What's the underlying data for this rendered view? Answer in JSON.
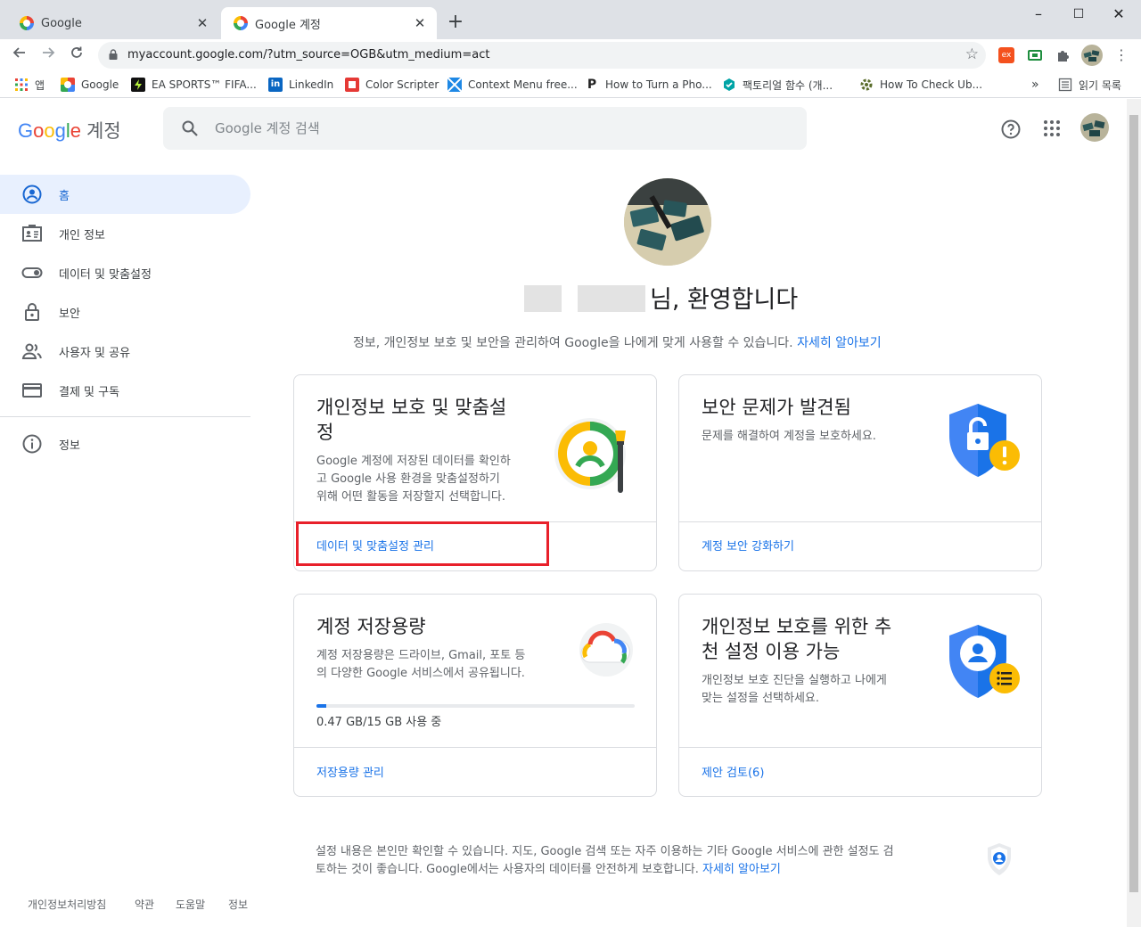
{
  "browser": {
    "tabs": [
      {
        "title": "Google",
        "close": "✕"
      },
      {
        "title": "Google 계정",
        "close": "✕"
      }
    ],
    "new_tab": "+",
    "window_controls": [
      "–",
      "☐",
      "✕"
    ],
    "url": "myaccount.google.com/?utm_source=OGB&utm_medium=act",
    "bookmarks": [
      {
        "label": "앱",
        "icon": "apps-grid-icon"
      },
      {
        "label": "Google",
        "icon": "google-icon"
      },
      {
        "label": "EA SPORTS™ FIFA...",
        "icon": "fifa-icon"
      },
      {
        "label": "LinkedIn",
        "icon": "linkedin-icon"
      },
      {
        "label": "Color Scripter",
        "icon": "color-scripter-icon"
      },
      {
        "label": "Context Menu free...",
        "icon": "context-menu-icon"
      },
      {
        "label": "How to Turn a Pho...",
        "icon": "p-icon"
      },
      {
        "label": "팩토리얼 함수 (개...",
        "icon": "factorial-icon"
      },
      {
        "label": "How To Check Ub...",
        "icon": "ubuntu-icon"
      }
    ],
    "bookmarks_overflow": "»",
    "reading_list": "읽기 목록",
    "extension_badge": "ex"
  },
  "header": {
    "logo_google": "Google",
    "logo_suffix": "계정",
    "search_placeholder": "Google 계정 검색"
  },
  "sidebar": {
    "items": [
      {
        "label": "홈",
        "icon": "home-user-icon"
      },
      {
        "label": "개인 정보",
        "icon": "id-card-icon"
      },
      {
        "label": "데이터 및 맞춤설정",
        "icon": "toggle-icon"
      },
      {
        "label": "보안",
        "icon": "lock-icon"
      },
      {
        "label": "사용자 및 공유",
        "icon": "people-icon"
      },
      {
        "label": "결제 및 구독",
        "icon": "credit-card-icon"
      }
    ],
    "info": {
      "label": "정보",
      "icon": "info-icon"
    }
  },
  "main": {
    "greeting": "님, 환영합니다",
    "intro": "정보, 개인정보 보호 및 보안을 관리하여 Google을 나에게 맞게 사용할 수 있습니다.",
    "intro_link": "자세히 알아보기",
    "cards": [
      {
        "title_line1": "개인정보 보호 및 맞춤설",
        "title_line2": "정",
        "desc_lines": [
          "Google 계정에 저장된 데이터를 확인하",
          "고 Google 사용 환경을 맞춤설정하기",
          "위해 어떤 활동을 저장할지 선택합니다."
        ],
        "link": "데이터 및 맞춤설정 관리"
      },
      {
        "title_line1": "보안 문제가 발견됨",
        "desc_lines": [
          "문제를 해결하여 계정을 보호하세요."
        ],
        "link": "계정 보안 강화하기"
      },
      {
        "title_line1": "계정 저장용량",
        "desc_lines": [
          "계정 저장용량은 드라이브, Gmail, 포토 등",
          "의 다양한 Google 서비스에서 공유됩니다."
        ],
        "usage": "0.47 GB/15 GB 사용 중",
        "usage_fraction": 0.031,
        "link": "저장용량 관리"
      },
      {
        "title_line1": "개인정보 보호를 위한 추",
        "title_line2": "천 설정 이용 가능",
        "desc_lines": [
          "개인정보 보호 진단을 실행하고 나에게",
          "맞는 설정을 선택하세요."
        ],
        "link": "제안 검토(6)"
      }
    ],
    "footer_note_line1": "설정 내용은 본인만 확인할 수 있습니다. 지도, Google 검색 또는 자주 이용하는 기타 Google 서비스에 관한 설정도 검",
    "footer_note_line2": "토하는 것이 좋습니다. Google에서는 사용자의 데이터를 안전하게 보호합니다.",
    "footer_note_link": "자세히 알아보기"
  },
  "footer": {
    "links": [
      "개인정보처리방침",
      "약관",
      "도움말",
      "정보"
    ]
  },
  "colors": {
    "accent": "#1a73e8",
    "nav_active_bg": "#e8f0fe",
    "highlight_box": "#e8202a",
    "shield_blue": "#4285f4",
    "warning_yellow": "#fbbc04"
  }
}
